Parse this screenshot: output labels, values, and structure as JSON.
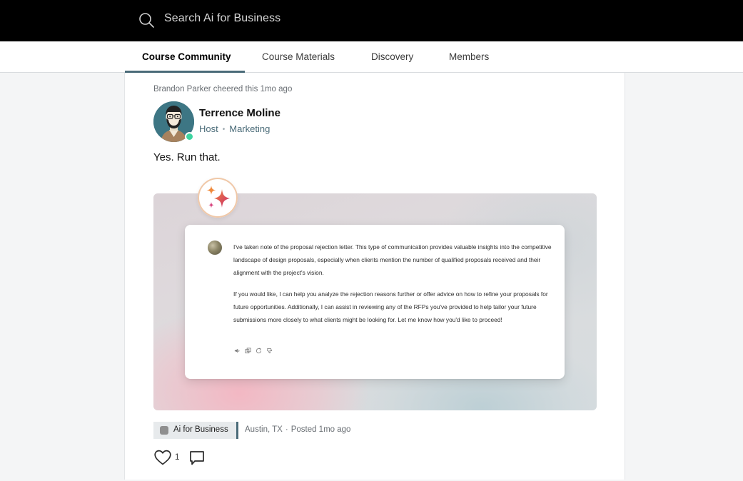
{
  "search": {
    "placeholder": "Search Ai for Business"
  },
  "tabs": [
    {
      "label": "Course Community",
      "active": true
    },
    {
      "label": "Course Materials",
      "active": false
    },
    {
      "label": "Discovery",
      "active": false
    },
    {
      "label": "Members",
      "active": false
    }
  ],
  "post": {
    "cheer_text": "Brandon Parker cheered this 1mo ago",
    "author": {
      "name": "Terrence Moline",
      "role": "Host",
      "team": "Marketing",
      "online": true
    },
    "body": "Yes. Run that.",
    "media": {
      "paragraphs": [
        "I've taken note of the proposal rejection letter. This type of communication provides valuable insights into the competitive landscape of design proposals, especially when clients mention the number of qualified proposals received and their alignment with the project's vision.",
        "If you would like, I can help you analyze the rejection reasons further or offer advice on how to refine your proposals for future opportunities. Additionally, I can assist in reviewing any of the RFPs you've provided to help tailor your future submissions more closely to what clients might be looking for. Let me know how you'd like to proceed!"
      ]
    },
    "space_chip": "Ai for Business",
    "location": "Austin, TX",
    "separator": "·",
    "posted": "Posted 1mo ago",
    "like_count": "1"
  },
  "colors": {
    "accent": "#4a6b78",
    "topbar": "#000000",
    "online": "#3dd4a0"
  }
}
